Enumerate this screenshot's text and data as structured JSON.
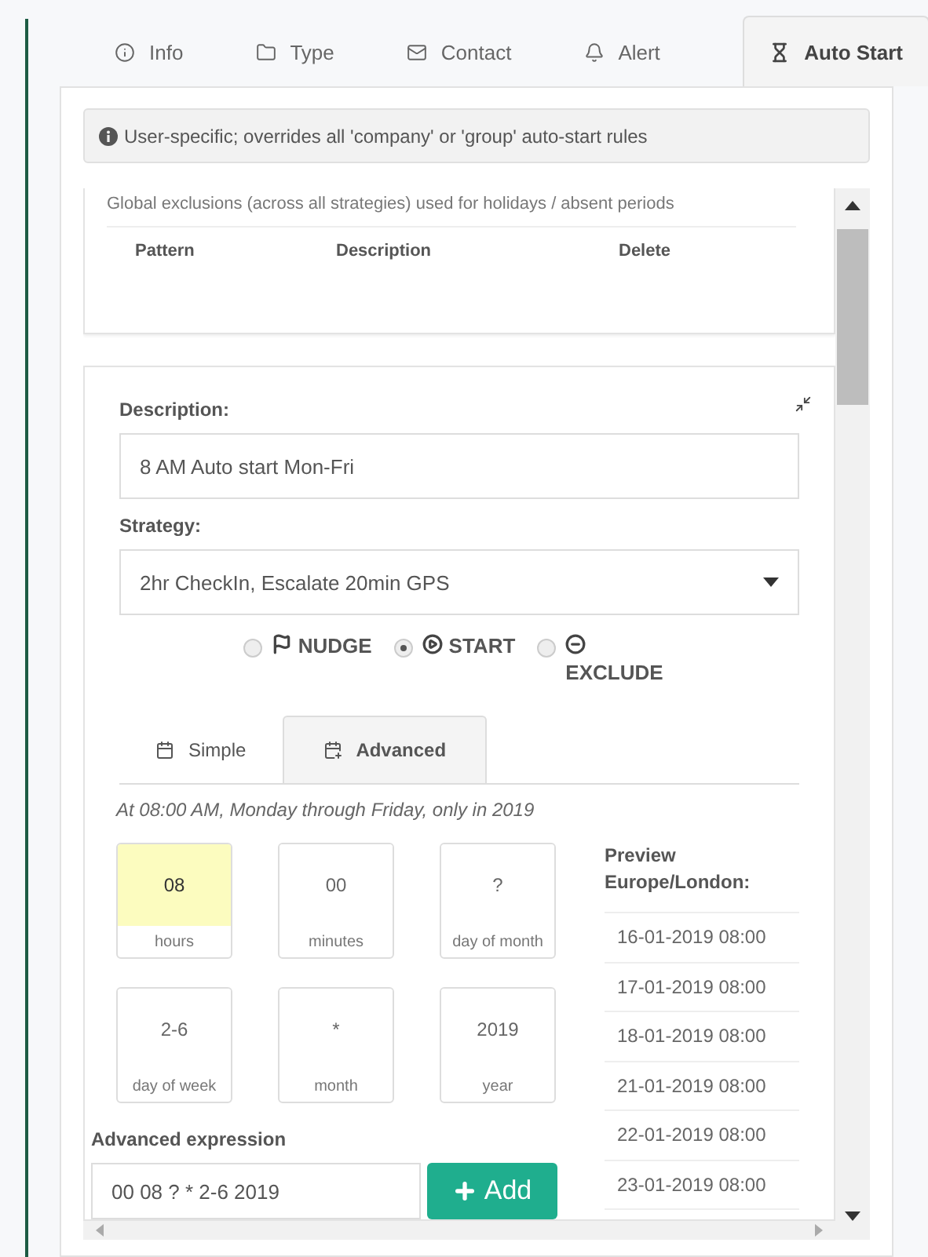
{
  "tabs": [
    {
      "label": "Info",
      "selected": false
    },
    {
      "label": "Type",
      "selected": false
    },
    {
      "label": "Contact",
      "selected": false
    },
    {
      "label": "Alert",
      "selected": false
    },
    {
      "label": "Auto Start",
      "selected": true
    }
  ],
  "notice": "User-specific; overrides all 'company' or 'group' auto-start rules",
  "exclusions": {
    "caption": "Global exclusions (across all strategies) used for holidays / absent periods",
    "columns": [
      "Pattern",
      "Description",
      "Delete"
    ]
  },
  "rule": {
    "description_label": "Description:",
    "description": "8 AM Auto start Mon-Fri",
    "strategy_label": "Strategy:",
    "strategy": "2hr CheckIn, Escalate 20min GPS",
    "modes": [
      {
        "label": "NUDGE",
        "selected": false
      },
      {
        "label": "START",
        "selected": true
      },
      {
        "label": "EXCLUDE",
        "selected": false
      }
    ],
    "subtabs": [
      {
        "label": "Simple",
        "selected": false
      },
      {
        "label": "Advanced",
        "selected": true
      }
    ],
    "summary": "At 08:00 AM, Monday through Friday, only in 2019",
    "fields": [
      {
        "value": "08",
        "label": "hours",
        "highlighted": true
      },
      {
        "value": "00",
        "label": "minutes",
        "highlighted": false
      },
      {
        "value": "?",
        "label": "day of month",
        "highlighted": false
      },
      {
        "value": "2-6",
        "label": "day of week",
        "highlighted": false
      },
      {
        "value": "*",
        "label": "month",
        "highlighted": false
      },
      {
        "value": "2019",
        "label": "year",
        "highlighted": false
      }
    ],
    "expression_label": "Advanced expression",
    "expression": "00 08 ? * 2-6 2019",
    "add_button": "Add",
    "preview_title": "Preview Europe/London:",
    "preview": [
      "16-01-2019 08:00",
      "17-01-2019 08:00",
      "18-01-2019 08:00",
      "21-01-2019 08:00",
      "22-01-2019 08:00",
      "23-01-2019 08:00"
    ]
  }
}
